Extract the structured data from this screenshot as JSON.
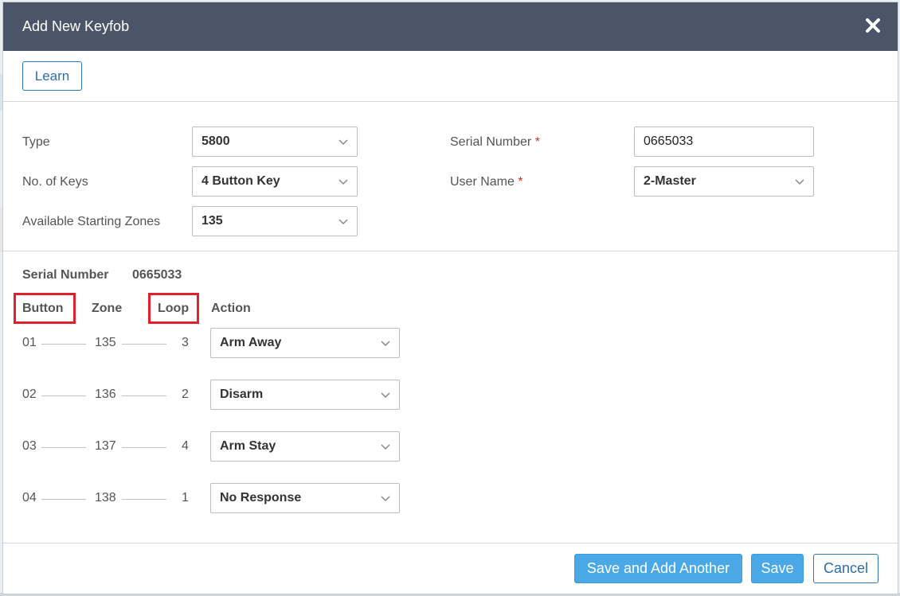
{
  "modal": {
    "title": "Add New Keyfob",
    "close_icon": "close-icon"
  },
  "learn_button": "Learn",
  "form": {
    "type_label": "Type",
    "type_value": "5800",
    "keys_label": "No. of Keys",
    "keys_value": "4 Button Key",
    "zones_label": "Available Starting Zones",
    "zones_value": "135",
    "serial_label": "Serial Number",
    "serial_value": "0665033",
    "user_label": "User Name",
    "user_value": "2-Master",
    "required_mark": "*"
  },
  "keys": {
    "serial_label": "Serial Number",
    "serial_value": "0665033",
    "headers": {
      "button": "Button",
      "zone": "Zone",
      "loop": "Loop",
      "action": "Action"
    },
    "rows": [
      {
        "button": "01",
        "zone": "135",
        "loop": "3",
        "action": "Arm Away"
      },
      {
        "button": "02",
        "zone": "136",
        "loop": "2",
        "action": "Disarm"
      },
      {
        "button": "03",
        "zone": "137",
        "loop": "4",
        "action": "Arm Stay"
      },
      {
        "button": "04",
        "zone": "138",
        "loop": "1",
        "action": "No Response"
      }
    ]
  },
  "footer": {
    "save_add_label": "Save and Add Another",
    "save_label": "Save",
    "cancel_label": "Cancel"
  },
  "colors": {
    "header_bg": "#4a5668",
    "primary": "#4aa8e6",
    "highlight": "#e0212b",
    "required": "#d0342c"
  }
}
